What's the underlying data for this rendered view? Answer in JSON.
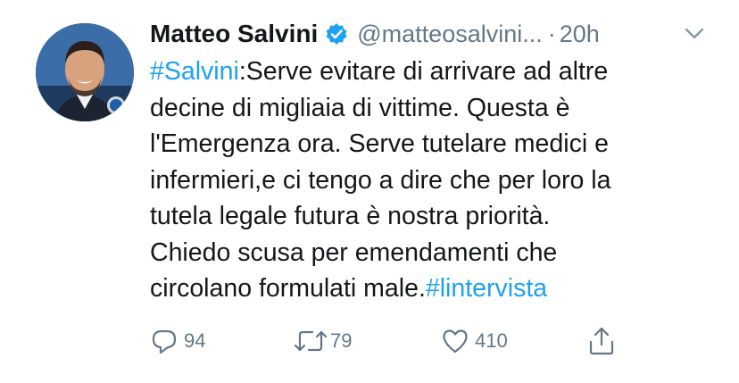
{
  "author": {
    "name": "Matteo Salvini",
    "handle": "@matteosalvini...",
    "separator": "·",
    "time": "20h"
  },
  "tweet": {
    "lines": [
      [
        {
          "text": "#Salvini",
          "hashtag": true
        },
        {
          "text": ":Serve evitare di arrivare ad altre",
          "hashtag": false
        }
      ],
      [
        {
          "text": "decine di migliaia di vittime. Questa è",
          "hashtag": false
        }
      ],
      [
        {
          "text": "l'Emergenza ora. Serve tutelare medici e",
          "hashtag": false
        }
      ],
      [
        {
          "text": "infermieri,e ci tengo a dire che per loro la",
          "hashtag": false
        }
      ],
      [
        {
          "text": "tutela legale futura è nostra priorità.",
          "hashtag": false
        }
      ],
      [
        {
          "text": "Chiedo scusa per emendamenti che",
          "hashtag": false
        }
      ],
      [
        {
          "text": "circolano formulati male.",
          "hashtag": false
        },
        {
          "text": "#lintervista",
          "hashtag": true
        }
      ]
    ]
  },
  "actions": {
    "reply_count": "94",
    "retweet_count": "79",
    "like_count": "410"
  },
  "colors": {
    "text": "#14171a",
    "secondary": "#657786",
    "link": "#1da1f2",
    "verified": "#1da1f2"
  },
  "icons": {
    "avatar": "profile-photo",
    "verified": "verified-badge-icon",
    "caret": "chevron-down-icon",
    "reply": "reply-bubble-icon",
    "retweet": "retweet-icon",
    "like": "heart-icon",
    "share": "share-icon"
  }
}
